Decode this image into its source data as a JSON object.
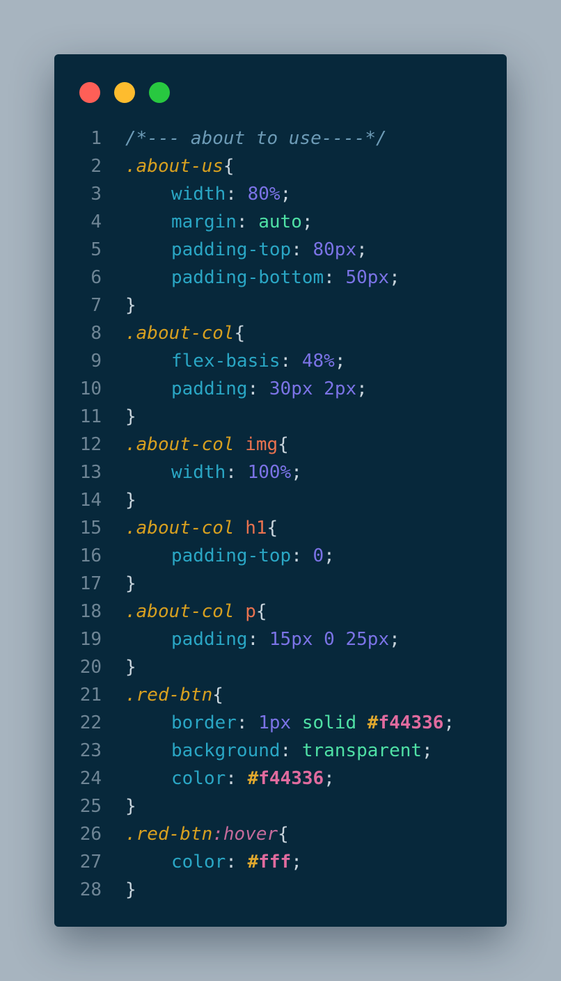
{
  "colors": {
    "background": "#a7b4bf",
    "window": "#07283b",
    "dot_red": "#ff5f57",
    "dot_yellow": "#febc2e",
    "dot_green": "#28c840"
  },
  "window_controls": {
    "close": "red-dot",
    "minimize": "yellow-dot",
    "maximize": "green-dot"
  },
  "code": {
    "lines": [
      {
        "n": "1",
        "indent": 0,
        "tokens": [
          {
            "t": "/*--- about to use----*/",
            "c": "comment"
          }
        ]
      },
      {
        "n": "2",
        "indent": 0,
        "tokens": [
          {
            "t": ".about-us",
            "c": "selector"
          },
          {
            "t": "{",
            "c": "brace"
          }
        ]
      },
      {
        "n": "3",
        "indent": 1,
        "tokens": [
          {
            "t": "width",
            "c": "prop"
          },
          {
            "t": ": ",
            "c": "punct"
          },
          {
            "t": "80%",
            "c": "num"
          },
          {
            "t": ";",
            "c": "punct"
          }
        ]
      },
      {
        "n": "4",
        "indent": 1,
        "tokens": [
          {
            "t": "margin",
            "c": "prop"
          },
          {
            "t": ": ",
            "c": "punct"
          },
          {
            "t": "auto",
            "c": "kw"
          },
          {
            "t": ";",
            "c": "punct"
          }
        ]
      },
      {
        "n": "5",
        "indent": 1,
        "tokens": [
          {
            "t": "padding-top",
            "c": "prop"
          },
          {
            "t": ": ",
            "c": "punct"
          },
          {
            "t": "80px",
            "c": "num"
          },
          {
            "t": ";",
            "c": "punct"
          }
        ]
      },
      {
        "n": "6",
        "indent": 1,
        "tokens": [
          {
            "t": "padding-bottom",
            "c": "prop"
          },
          {
            "t": ": ",
            "c": "punct"
          },
          {
            "t": "50px",
            "c": "num"
          },
          {
            "t": ";",
            "c": "punct"
          }
        ]
      },
      {
        "n": "7",
        "indent": 0,
        "tokens": [
          {
            "t": "}",
            "c": "brace"
          }
        ]
      },
      {
        "n": "8",
        "indent": 0,
        "tokens": [
          {
            "t": ".about-col",
            "c": "selector"
          },
          {
            "t": "{",
            "c": "brace"
          }
        ]
      },
      {
        "n": "9",
        "indent": 1,
        "tokens": [
          {
            "t": "flex-basis",
            "c": "prop"
          },
          {
            "t": ": ",
            "c": "punct"
          },
          {
            "t": "48%",
            "c": "num"
          },
          {
            "t": ";",
            "c": "punct"
          }
        ]
      },
      {
        "n": "10",
        "indent": 1,
        "tokens": [
          {
            "t": "padding",
            "c": "prop"
          },
          {
            "t": ": ",
            "c": "punct"
          },
          {
            "t": "30px",
            "c": "num"
          },
          {
            "t": " ",
            "c": "punct"
          },
          {
            "t": "2px",
            "c": "num"
          },
          {
            "t": ";",
            "c": "punct"
          }
        ]
      },
      {
        "n": "11",
        "indent": 0,
        "tokens": [
          {
            "t": "}",
            "c": "brace"
          }
        ]
      },
      {
        "n": "12",
        "indent": 0,
        "tokens": [
          {
            "t": ".about-col",
            "c": "selector"
          },
          {
            "t": " ",
            "c": "punct"
          },
          {
            "t": "img",
            "c": "tag"
          },
          {
            "t": "{",
            "c": "brace"
          }
        ]
      },
      {
        "n": "13",
        "indent": 1,
        "tokens": [
          {
            "t": "width",
            "c": "prop"
          },
          {
            "t": ": ",
            "c": "punct"
          },
          {
            "t": "100%",
            "c": "num"
          },
          {
            "t": ";",
            "c": "punct"
          }
        ]
      },
      {
        "n": "14",
        "indent": 0,
        "tokens": [
          {
            "t": "}",
            "c": "brace"
          }
        ]
      },
      {
        "n": "15",
        "indent": 0,
        "tokens": [
          {
            "t": ".about-col",
            "c": "selector"
          },
          {
            "t": " ",
            "c": "punct"
          },
          {
            "t": "h1",
            "c": "tag"
          },
          {
            "t": "{",
            "c": "brace"
          }
        ]
      },
      {
        "n": "16",
        "indent": 1,
        "tokens": [
          {
            "t": "padding-top",
            "c": "prop"
          },
          {
            "t": ": ",
            "c": "punct"
          },
          {
            "t": "0",
            "c": "num"
          },
          {
            "t": ";",
            "c": "punct"
          }
        ]
      },
      {
        "n": "17",
        "indent": 0,
        "tokens": [
          {
            "t": "}",
            "c": "brace"
          }
        ]
      },
      {
        "n": "18",
        "indent": 0,
        "tokens": [
          {
            "t": ".about-col",
            "c": "selector"
          },
          {
            "t": " ",
            "c": "punct"
          },
          {
            "t": "p",
            "c": "tag"
          },
          {
            "t": "{",
            "c": "brace"
          }
        ]
      },
      {
        "n": "19",
        "indent": 1,
        "tokens": [
          {
            "t": "padding",
            "c": "prop"
          },
          {
            "t": ": ",
            "c": "punct"
          },
          {
            "t": "15px",
            "c": "num"
          },
          {
            "t": " ",
            "c": "punct"
          },
          {
            "t": "0",
            "c": "num"
          },
          {
            "t": " ",
            "c": "punct"
          },
          {
            "t": "25px",
            "c": "num"
          },
          {
            "t": ";",
            "c": "punct"
          }
        ]
      },
      {
        "n": "20",
        "indent": 0,
        "tokens": [
          {
            "t": "}",
            "c": "brace"
          }
        ]
      },
      {
        "n": "21",
        "indent": 0,
        "tokens": [
          {
            "t": ".red-btn",
            "c": "selector"
          },
          {
            "t": "{",
            "c": "brace"
          }
        ]
      },
      {
        "n": "22",
        "indent": 1,
        "tokens": [
          {
            "t": "border",
            "c": "prop"
          },
          {
            "t": ": ",
            "c": "punct"
          },
          {
            "t": "1px",
            "c": "num"
          },
          {
            "t": " ",
            "c": "punct"
          },
          {
            "t": "solid",
            "c": "kw"
          },
          {
            "t": " ",
            "c": "punct"
          },
          {
            "t": "#",
            "c": "hash"
          },
          {
            "t": "f44336",
            "c": "hex"
          },
          {
            "t": ";",
            "c": "punct"
          }
        ]
      },
      {
        "n": "23",
        "indent": 1,
        "tokens": [
          {
            "t": "background",
            "c": "prop"
          },
          {
            "t": ": ",
            "c": "punct"
          },
          {
            "t": "transparent",
            "c": "kw"
          },
          {
            "t": ";",
            "c": "punct"
          }
        ]
      },
      {
        "n": "24",
        "indent": 1,
        "tokens": [
          {
            "t": "color",
            "c": "prop"
          },
          {
            "t": ": ",
            "c": "punct"
          },
          {
            "t": "#",
            "c": "hash"
          },
          {
            "t": "f44336",
            "c": "hex"
          },
          {
            "t": ";",
            "c": "punct"
          }
        ]
      },
      {
        "n": "25",
        "indent": 0,
        "tokens": [
          {
            "t": "}",
            "c": "brace"
          }
        ]
      },
      {
        "n": "26",
        "indent": 0,
        "tokens": [
          {
            "t": ".red-btn",
            "c": "selector"
          },
          {
            "t": ":hover",
            "c": "pseudo"
          },
          {
            "t": "{",
            "c": "brace"
          }
        ]
      },
      {
        "n": "27",
        "indent": 1,
        "tokens": [
          {
            "t": "color",
            "c": "prop"
          },
          {
            "t": ": ",
            "c": "punct"
          },
          {
            "t": "#",
            "c": "hash"
          },
          {
            "t": "fff",
            "c": "hex"
          },
          {
            "t": ";",
            "c": "punct"
          }
        ]
      },
      {
        "n": "28",
        "indent": 0,
        "tokens": [
          {
            "t": "}",
            "c": "brace"
          }
        ]
      }
    ]
  }
}
